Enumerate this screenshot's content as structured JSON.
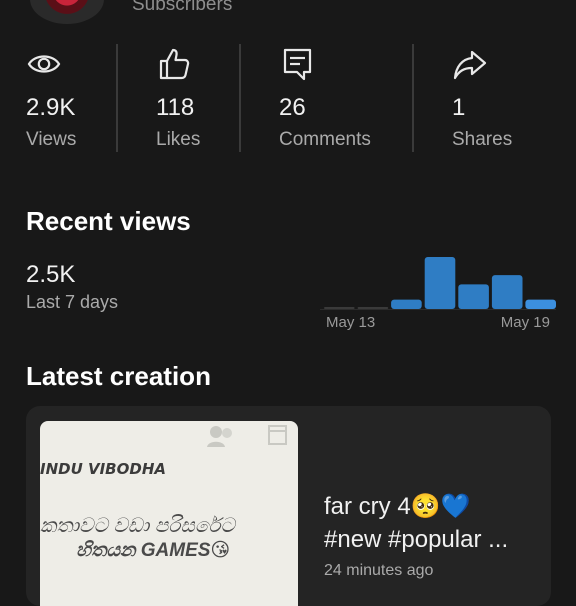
{
  "channel": {
    "subscribers_label": "Subscribers"
  },
  "stats": [
    {
      "icon": "eye-icon",
      "value": "2.9K",
      "label": "Views"
    },
    {
      "icon": "thumbs-up-icon",
      "value": "118",
      "label": "Likes"
    },
    {
      "icon": "comment-icon",
      "value": "26",
      "label": "Comments"
    },
    {
      "icon": "share-icon",
      "value": "1",
      "label": "Shares"
    }
  ],
  "recent_views": {
    "title": "Recent views",
    "value": "2.5K",
    "period": "Last 7 days",
    "x_start_label": "May 13",
    "x_end_label": "May 19"
  },
  "chart_data": {
    "type": "bar",
    "categories": [
      "May 13",
      "May 14",
      "May 15",
      "May 16",
      "May 17",
      "May 18",
      "May 19"
    ],
    "values": [
      10,
      10,
      130,
      720,
      340,
      470,
      130
    ],
    "colors": {
      "primary": "#2f7dc4",
      "light": "#3c8fde",
      "empty": "#3a3a3a"
    }
  },
  "latest": {
    "title": "Latest creation",
    "thumb_name": "INDU VIBODHA",
    "thumb_line1": "කතාවට වඩා පරිසරේට",
    "thumb_line2": "හිතයන GAMES😘",
    "video_title_line1": "far cry 4🥺💙",
    "video_title_line2": "#new #popular ...",
    "time_ago": "24 minutes ago"
  }
}
